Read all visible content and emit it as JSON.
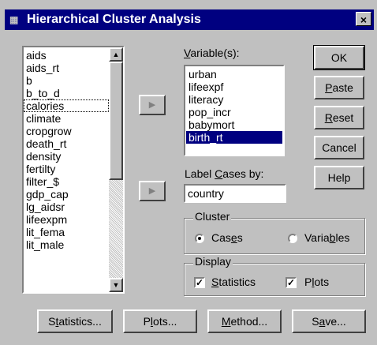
{
  "window": {
    "title": "Hierarchical Cluster Analysis",
    "close_glyph": "×",
    "icon": "spss-app-icon"
  },
  "source_list": {
    "items": [
      "aids",
      "aids_rt",
      "b",
      "b_to_d",
      "calories",
      "climate",
      "cropgrow",
      "death_rt",
      "density",
      "fertilty",
      "filter_$",
      "gdp_cap",
      "lg_aidsr",
      "lifeexpm",
      "lit_fema",
      "lit_male"
    ],
    "focused_item": "calories"
  },
  "transfer_glyph": "▶",
  "variables": {
    "label": "Variable(s):",
    "mnemonic": "V",
    "items": [
      "urban",
      "lifeexpf",
      "literacy",
      "pop_incr",
      "babymort",
      "birth_rt"
    ],
    "selected_item": "birth_rt"
  },
  "label_cases": {
    "label_before": "Label ",
    "mnemonic": "C",
    "label_after": "ases by:",
    "value": "country"
  },
  "cluster_group": {
    "title": "Cluster",
    "cases_before": "Cas",
    "cases_mnemonic": "e",
    "cases_after": "s",
    "variables_before": "Varia",
    "variables_mnemonic": "b",
    "variables_after": "les",
    "selected": "Cases"
  },
  "display_group": {
    "title": "Display",
    "statistics_mnemonic": "S",
    "statistics_after": "tatistics",
    "plots_before": "P",
    "plots_mnemonic": "l",
    "plots_after": "ots",
    "statistics_checked": true,
    "plots_checked": true,
    "check_glyph": "✓"
  },
  "side_buttons": {
    "ok": "OK",
    "paste_mnemonic": "P",
    "paste_after": "aste",
    "reset_mnemonic": "R",
    "reset_after": "eset",
    "cancel": "Cancel",
    "help": "Help"
  },
  "bottom_buttons": {
    "statistics_before": "S",
    "statistics_mnemonic": "t",
    "statistics_after": "atistics...",
    "plots_before": "P",
    "plots_mnemonic": "l",
    "plots_after": "ots...",
    "method_mnemonic": "M",
    "method_after": "ethod...",
    "save_before": "S",
    "save_mnemonic": "a",
    "save_after": "ve..."
  },
  "scrollbar_glyphs": {
    "up": "▲",
    "down": "▼"
  }
}
